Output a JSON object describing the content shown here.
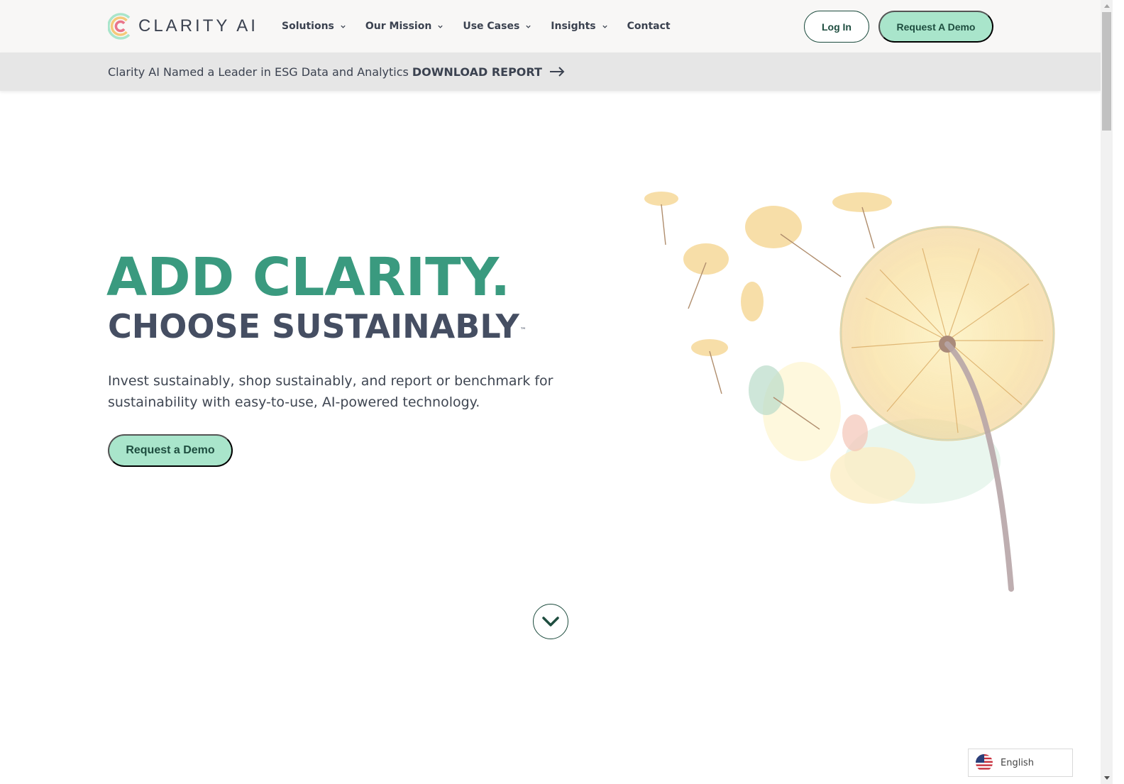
{
  "brand": {
    "name": "CLARITY AI",
    "accent": "#3a9a7f",
    "button_bg": "#a9e5cb",
    "dark_green": "#1e4d3f"
  },
  "nav": {
    "items": [
      {
        "label": "Solutions",
        "has_dropdown": true
      },
      {
        "label": "Our Mission",
        "has_dropdown": true
      },
      {
        "label": "Use Cases",
        "has_dropdown": true
      },
      {
        "label": "Insights",
        "has_dropdown": true
      },
      {
        "label": "Contact",
        "has_dropdown": false
      }
    ],
    "login_label": "Log In",
    "demo_label": "Request A Demo"
  },
  "banner": {
    "text": "Clarity AI Named a Leader in ESG Data and Analytics",
    "cta_label": "DOWNLOAD REPORT",
    "cta_icon": "arrow-right-icon"
  },
  "hero": {
    "headline": "ADD CLARITY.",
    "subheadline": "CHOOSE SUSTAINABLY",
    "trademark": "™",
    "description": "Invest sustainably, shop sustainably, and report or benchmark for sustainability with easy-to-use, AI-powered technology.",
    "cta_label": "Request a Demo",
    "illustration": "watercolor-dandelion"
  },
  "scroll_down": {
    "icon": "chevron-down-icon"
  },
  "language": {
    "label": "English",
    "flag": "us-flag-icon"
  }
}
